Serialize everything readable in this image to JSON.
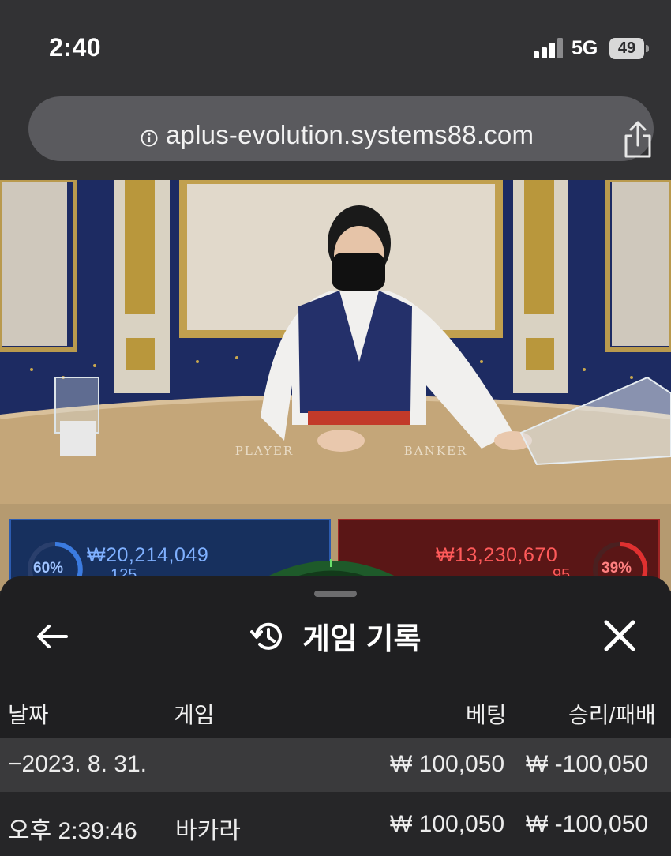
{
  "status_bar": {
    "time": "2:40",
    "network": "5G",
    "battery": "49"
  },
  "browser": {
    "url": "aplus-evolution.systems88.com"
  },
  "table_scene": {
    "player_label": "PLAYER",
    "banker_label": "BANKER"
  },
  "bets": {
    "player": {
      "percent": "60%",
      "amount": "₩20,214,049",
      "count": "125"
    },
    "banker": {
      "percent": "39%",
      "amount": "₩13,230,670",
      "count": "95"
    }
  },
  "sheet": {
    "title": "게임 기록",
    "columns": {
      "date": "날짜",
      "game": "게임",
      "bet": "베팅",
      "result": "승리/패배"
    },
    "date_row": {
      "date": "−2023. 8. 31.",
      "bet": "₩ 100,050",
      "result": "₩ -100,050"
    },
    "rows": [
      {
        "time": "오후 2:39:46",
        "game": "바카라",
        "bet": "₩ 100,050",
        "result": "₩ -100,050"
      }
    ]
  },
  "colors": {
    "player_blue": "#2c5cb0",
    "banker_red": "#a02626",
    "sheet_bg": "#1f1f21"
  }
}
